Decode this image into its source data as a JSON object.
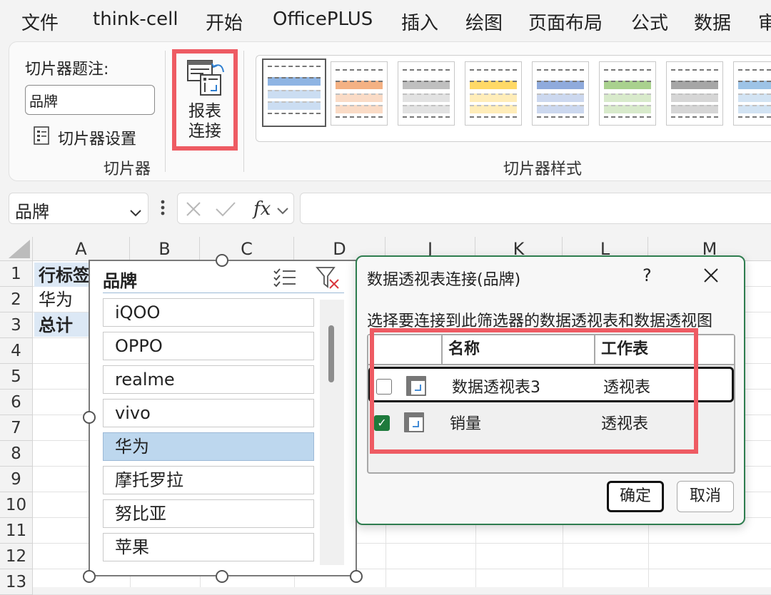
{
  "menu": {
    "tabs": [
      "文件",
      "think-cell",
      "开始",
      "OfficePLUS",
      "插入",
      "绘图",
      "页面布局",
      "公式",
      "数据",
      "审"
    ]
  },
  "ribbon": {
    "caption_label": "切片器题注:",
    "caption_value": "品牌",
    "settings_label": "切片器设置",
    "slicer_group_label": "切片器",
    "report_connections_label_line1": "报表",
    "report_connections_label_line2": "连接",
    "styles_group_label": "切片器样式",
    "style_colors": [
      "#8eb4e3",
      "#f4b183",
      "#bfbfbf",
      "#ffd966",
      "#8faadc",
      "#a9d18e",
      "#a6a6a6",
      "#9dc3e6"
    ]
  },
  "formula_bar": {
    "name_box": "品牌",
    "formula": ""
  },
  "sheet": {
    "columns": [
      "A",
      "B",
      "C",
      "D",
      "J",
      "K",
      "L",
      "M"
    ],
    "rows": [
      "1",
      "2",
      "3",
      "4",
      "5",
      "6",
      "7",
      "8",
      "9",
      "10",
      "11",
      "12",
      "13"
    ],
    "cells": {
      "A1": "行标签",
      "A2": "华为",
      "A3": "总计"
    }
  },
  "slicer": {
    "title": "品牌",
    "items": [
      "iQOO",
      "OPPO",
      "realme",
      "vivo",
      "华为",
      "摩托罗拉",
      "努比亚",
      "苹果"
    ],
    "selected": "华为"
  },
  "dialog": {
    "title": "数据透视表连接(品牌)",
    "help": "?",
    "description": "选择要连接到此筛选器的数据透视表和数据透视图",
    "col_name": "名称",
    "col_sheet": "工作表",
    "rows": [
      {
        "name": "数据透视表3",
        "sheet": "透视表",
        "checked": false
      },
      {
        "name": "销量",
        "sheet": "透视表",
        "checked": true
      }
    ],
    "ok": "确定",
    "cancel": "取消"
  }
}
